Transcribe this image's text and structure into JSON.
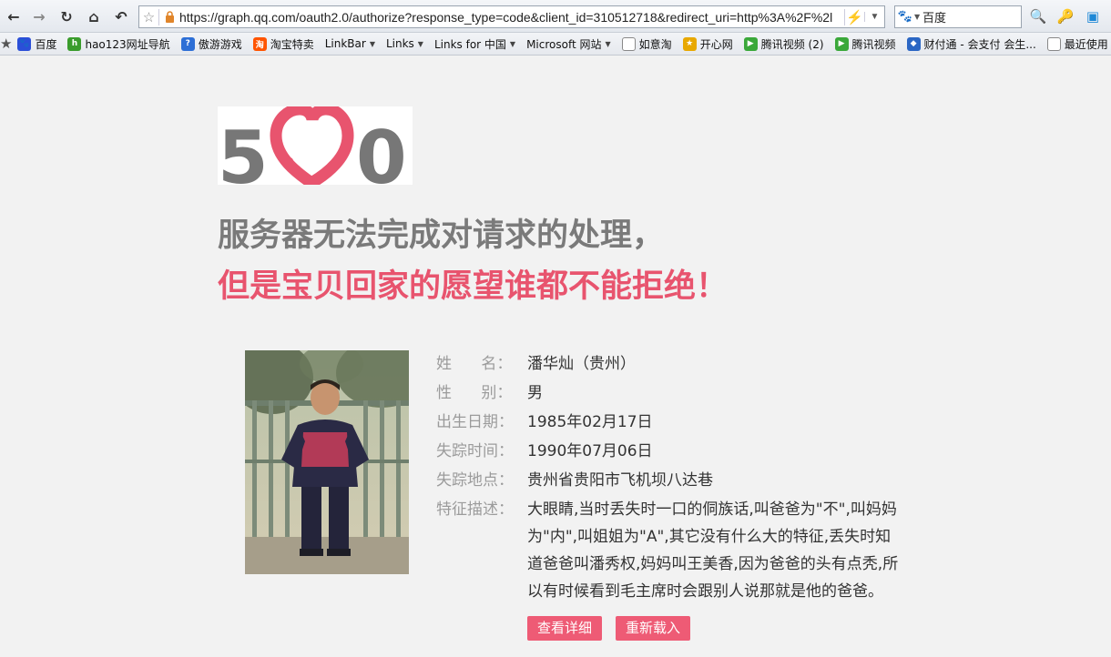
{
  "browser": {
    "address": {
      "url": "https://graph.qq.com/oauth2.0/authorize?response_type=code&client_id=310512718&redirect_uri=http%3A%2F%2l"
    },
    "search": {
      "engine_icon": "baidu-paw-icon",
      "value": "百度"
    },
    "bookmarks": [
      {
        "label": "百度",
        "icon": "baidu-paw-icon",
        "color": "#2b4fd8",
        "glyph": "🐾",
        "menu": false
      },
      {
        "label": "hao123网址导航",
        "icon": "hao123-icon",
        "color": "#3a9c2c",
        "glyph": "h",
        "menu": false
      },
      {
        "label": "傲游游戏",
        "icon": "maxthon-game-icon",
        "color": "#2d6fd6",
        "glyph": "?",
        "menu": false
      },
      {
        "label": "淘宝特卖",
        "icon": "taobao-icon",
        "color": "#ff5400",
        "glyph": "淘",
        "menu": false
      },
      {
        "label": "LinkBar",
        "icon": "",
        "color": "",
        "glyph": "",
        "menu": true
      },
      {
        "label": "Links",
        "icon": "",
        "color": "",
        "glyph": "",
        "menu": true
      },
      {
        "label": "Links for 中国",
        "icon": "",
        "color": "",
        "glyph": "",
        "menu": true
      },
      {
        "label": "Microsoft 网站",
        "icon": "",
        "color": "",
        "glyph": "",
        "menu": true
      },
      {
        "label": "如意淘",
        "icon": "page-icon",
        "color": "#ffffff",
        "glyph": "",
        "menu": false
      },
      {
        "label": "开心网",
        "icon": "kaixin-icon",
        "color": "#e8a800",
        "glyph": "★",
        "menu": false
      },
      {
        "label": "腾讯视频 (2)",
        "icon": "tencent-video-icon",
        "color": "#3aa83a",
        "glyph": "▶",
        "menu": false
      },
      {
        "label": "腾讯视频",
        "icon": "tencent-video-icon",
        "color": "#3aa83a",
        "glyph": "▶",
        "menu": false
      },
      {
        "label": "财付通 - 会支付 会生...",
        "icon": "tenpay-shield-icon",
        "color": "#2a66c4",
        "glyph": "◆",
        "menu": false
      },
      {
        "label": "最近使用",
        "icon": "page-icon",
        "color": "#ffffff",
        "glyph": "",
        "menu": false
      }
    ]
  },
  "page": {
    "logo_text": "500",
    "headline_1": "服务器无法完成对请求的处理，",
    "headline_2": "但是宝贝回家的愿望谁都不能拒绝！",
    "colors": {
      "accent": "#ee5b75",
      "heading_gray": "#7a7a7a",
      "background": "#f2f2f2"
    },
    "info": [
      {
        "label": "姓      名：",
        "value": "潘华灿（贵州）"
      },
      {
        "label": "性      别：",
        "value": "男"
      },
      {
        "label": "出生日期：",
        "value": "1985年02月17日"
      },
      {
        "label": "失踪时间：",
        "value": "1990年07月06日"
      },
      {
        "label": "失踪地点：",
        "value": "贵州省贵阳市飞机坝八达巷"
      },
      {
        "label": "特征描述：",
        "value": "大眼睛,当时丢失时一口的侗族话,叫爸爸为\"不\",叫妈妈为\"内\",叫姐姐为\"A\",其它没有什么大的特征,丢失时知道爸爸叫潘秀权,妈妈叫王美香,因为爸爸的头有点秃,所以有时候看到毛主席时会跟别人说那就是他的爸爸。"
      }
    ],
    "buttons": {
      "details": "查看详细",
      "reload": "重新载入"
    }
  }
}
